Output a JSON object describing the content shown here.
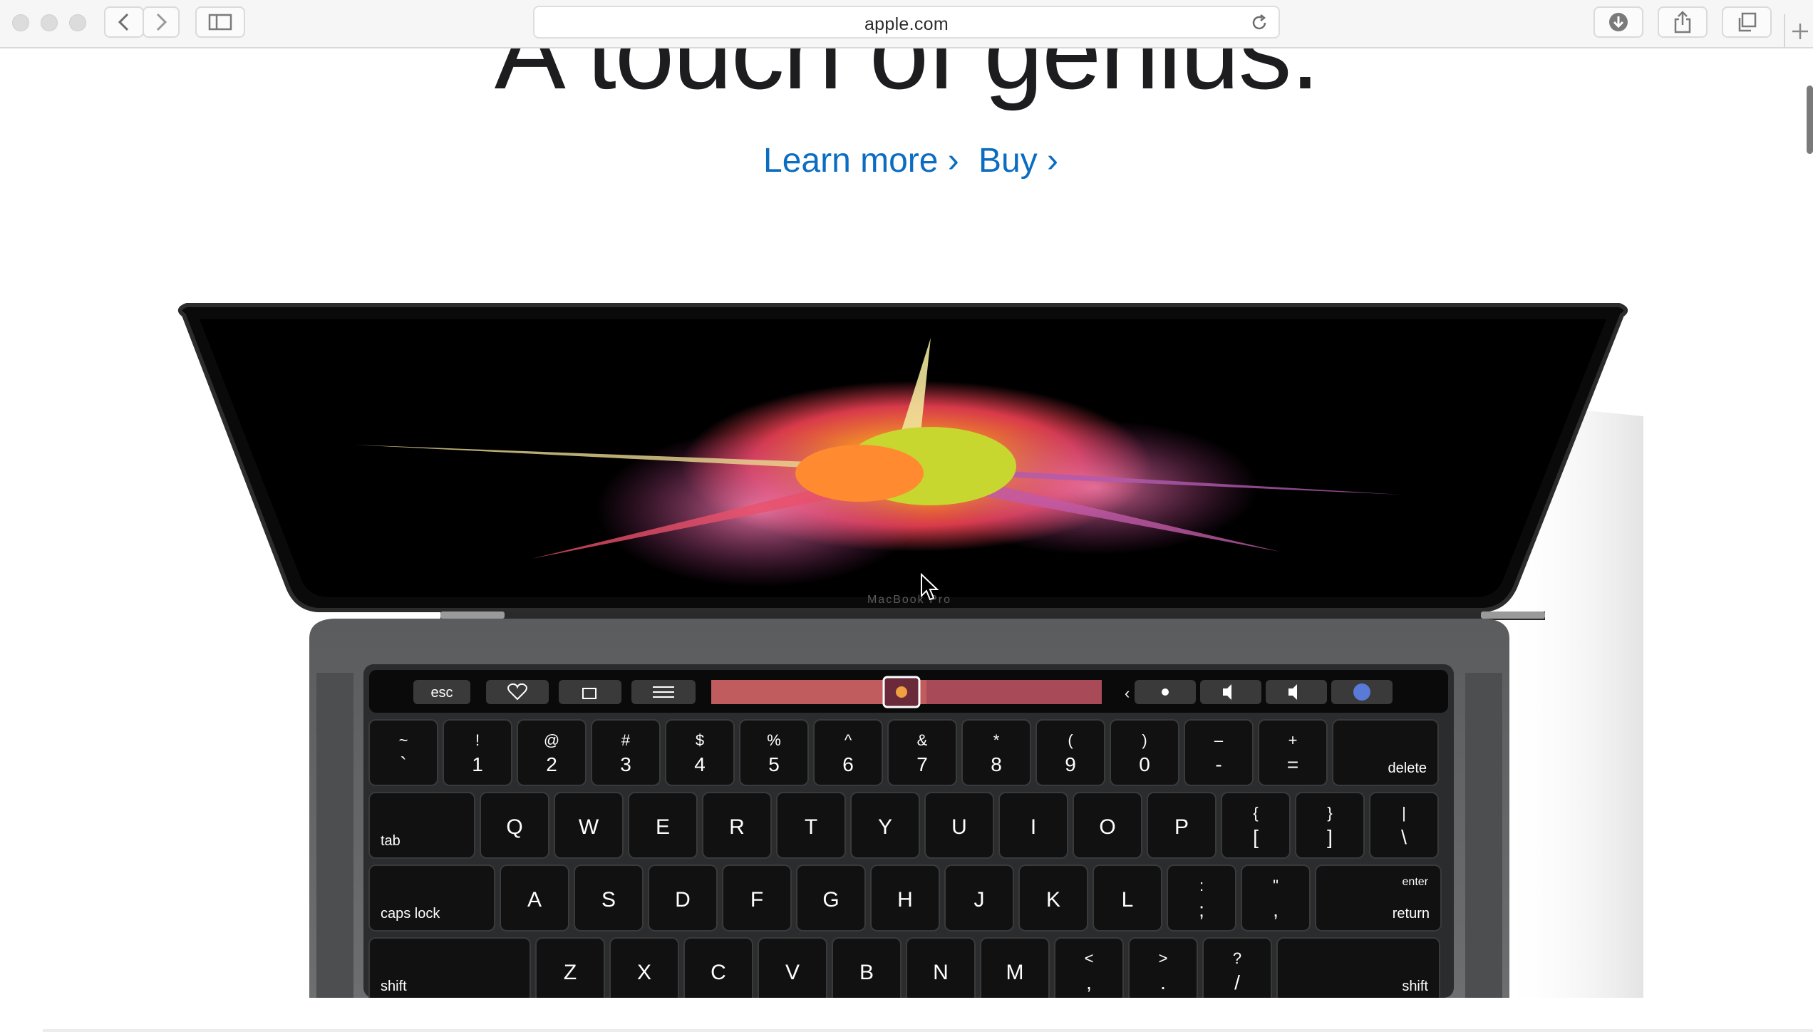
{
  "browser": {
    "url": "apple.com",
    "icons": {
      "back": "chevron-left-icon",
      "forward": "chevron-right-icon",
      "sidebar": "sidebar-icon",
      "reload": "reload-icon",
      "downloads": "download-icon",
      "share": "share-icon",
      "tabs": "tabs-overview-icon",
      "new_tab": "plus-icon"
    }
  },
  "hero": {
    "headline": "A touch of genius.",
    "learn_more": "Learn more ›",
    "buy": "Buy ›",
    "link_color": "#0a6dc2",
    "device_label": "MacBook Pro"
  },
  "touch_bar": {
    "esc": "esc",
    "icons": [
      "heart-icon",
      "rotate-icon",
      "adjust-sliders-icon",
      "brightness-icon",
      "volume-icon",
      "mute-icon",
      "siri-icon"
    ],
    "chevron": "‹"
  },
  "keyboard": {
    "row1": [
      {
        "top": "~",
        "bottom": "`"
      },
      {
        "top": "!",
        "bottom": "1"
      },
      {
        "top": "@",
        "bottom": "2"
      },
      {
        "top": "#",
        "bottom": "3"
      },
      {
        "top": "$",
        "bottom": "4"
      },
      {
        "top": "%",
        "bottom": "5"
      },
      {
        "top": "^",
        "bottom": "6"
      },
      {
        "top": "&",
        "bottom": "7"
      },
      {
        "top": "*",
        "bottom": "8"
      },
      {
        "top": "(",
        "bottom": "9"
      },
      {
        "top": ")",
        "bottom": "0"
      },
      {
        "top": "–",
        "bottom": "-"
      },
      {
        "top": "+",
        "bottom": "="
      },
      {
        "top": "",
        "bottom": "delete"
      }
    ],
    "row2": [
      "tab",
      "Q",
      "W",
      "E",
      "R",
      "T",
      "Y",
      "U",
      "I",
      "O",
      "P",
      {
        "top": "{",
        "bottom": "["
      },
      {
        "top": "}",
        "bottom": "]"
      },
      {
        "top": "|",
        "bottom": "\\"
      }
    ],
    "row3": [
      "caps lock",
      "A",
      "S",
      "D",
      "F",
      "G",
      "H",
      "J",
      "K",
      "L",
      {
        "top": ":",
        "bottom": ";"
      },
      {
        "top": "\"",
        "bottom": ","
      },
      {
        "top": "enter",
        "bottom": "return"
      }
    ],
    "row4": [
      "shift",
      "Z",
      "X",
      "C",
      "V",
      "B",
      "N",
      "M",
      {
        "top": "<",
        "bottom": ","
      },
      {
        "top": ">",
        "bottom": "."
      },
      {
        "top": "?",
        "bottom": "/"
      },
      "shift"
    ]
  }
}
